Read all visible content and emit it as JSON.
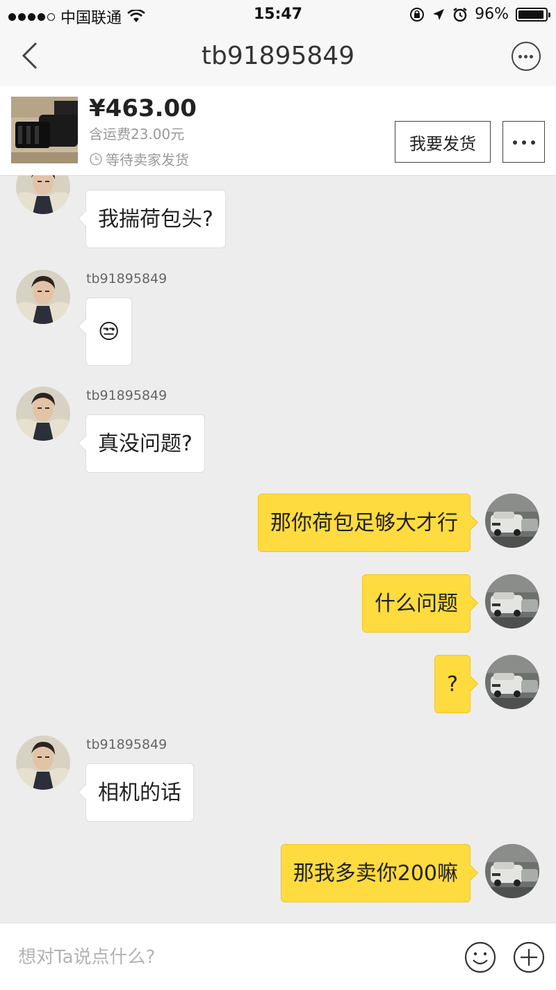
{
  "status_bar": {
    "carrier": "中国联通",
    "time": "15:47",
    "battery": "96%",
    "battery_level": 0.96
  },
  "nav": {
    "title": "tb91895849",
    "back_icon": "chevron-left-icon",
    "more_icon": "more-circle-icon"
  },
  "order": {
    "price": "¥463.00",
    "shipping": "含运费23.00元",
    "status": "等待卖家发货",
    "ship_button": "我要发货"
  },
  "messages": [
    {
      "side": "left",
      "sender": "",
      "text": "我揣荷包头?"
    },
    {
      "side": "left",
      "sender": "tb91895849",
      "text": "😒"
    },
    {
      "side": "left",
      "sender": "tb91895849",
      "text": "真没问题?"
    },
    {
      "side": "right",
      "text": "那你荷包足够大才行"
    },
    {
      "side": "right",
      "text": "什么问题"
    },
    {
      "side": "right",
      "text": "?"
    },
    {
      "side": "left",
      "sender": "tb91895849",
      "text": "相机的话"
    },
    {
      "side": "right",
      "text": "那我多卖你200嘛"
    }
  ],
  "input": {
    "placeholder": "想对Ta说点什么?"
  },
  "colors": {
    "self_bubble": "#fedb3e",
    "other_bubble": "#ffffff",
    "chat_background": "#ededed"
  }
}
